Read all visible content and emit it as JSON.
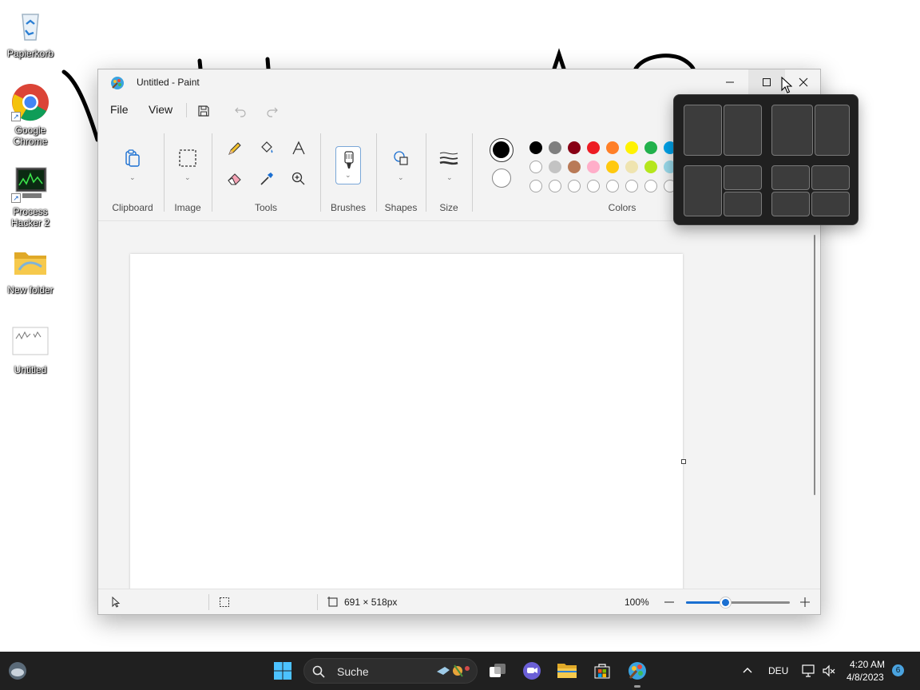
{
  "desktop": {
    "icons": [
      {
        "label": "Papierkorb",
        "icon": "recycle-bin-icon"
      },
      {
        "label": "Google Chrome",
        "icon": "chrome-icon"
      },
      {
        "label": "Process Hacker 2",
        "icon": "process-hacker-icon"
      },
      {
        "label": "New folder",
        "icon": "folder-icon"
      },
      {
        "label": "Untitled",
        "icon": "image-file-icon"
      }
    ]
  },
  "window": {
    "title": "Untitled - Paint",
    "menu": {
      "file": "File",
      "view": "View"
    },
    "ribbon_groups": {
      "clipboard": "Clipboard",
      "image": "Image",
      "tools": "Tools",
      "brushes": "Brushes",
      "shapes": "Shapes",
      "size": "Size",
      "colors": "Colors"
    },
    "palette": {
      "primary": "#000000",
      "secondary": "#ffffff",
      "row1": [
        "#000000",
        "#7f7f7f",
        "#880015",
        "#ed1c24",
        "#ff7f27",
        "#fff200",
        "#22b14c",
        "#00a2e8"
      ],
      "row2": [
        "#ffffff",
        "#c3c3c3",
        "#b97a57",
        "#ffaec9",
        "#ffc90e",
        "#efe4b0",
        "#b5e61d",
        "#99d9ea"
      ]
    },
    "status": {
      "canvas_size": "691 × 518px",
      "zoom": "100%",
      "zoom_fraction": 0.38
    }
  },
  "taskbar": {
    "search_label": "Suche",
    "language": "DEU",
    "time": "4:20 AM",
    "date": "4/8/2023",
    "notification_count": "6"
  }
}
